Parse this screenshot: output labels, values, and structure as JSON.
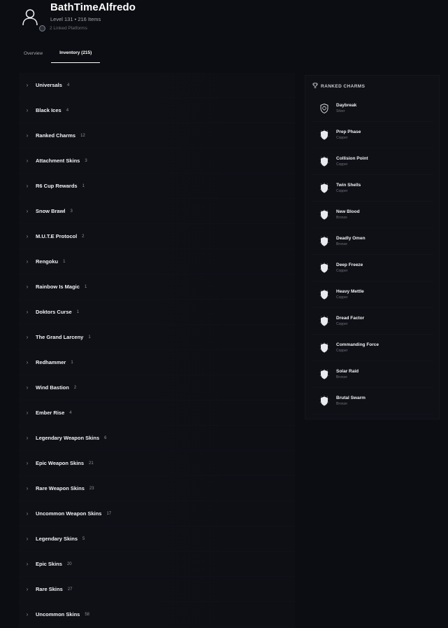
{
  "profile": {
    "username": "BathTimeAlfredo",
    "level_items": "Level 131 • 216 Items",
    "linked_platforms": "2 Linked Platforms"
  },
  "tabs": [
    {
      "label": "Overview",
      "active": false
    },
    {
      "label": "Inventory (215)",
      "active": true
    }
  ],
  "categories": [
    {
      "label": "Universals",
      "count": "4"
    },
    {
      "label": "Black Ices",
      "count": "4"
    },
    {
      "label": "Ranked Charms",
      "count": "12"
    },
    {
      "label": "Attachment Skins",
      "count": "3"
    },
    {
      "label": "R6 Cup Rewards",
      "count": "1"
    },
    {
      "label": "Snow Brawl",
      "count": "3"
    },
    {
      "label": "M.U.T.E Protocol",
      "count": "2"
    },
    {
      "label": "Rengoku",
      "count": "1"
    },
    {
      "label": "Rainbow Is Magic",
      "count": "1"
    },
    {
      "label": "Doktors Curse",
      "count": "1"
    },
    {
      "label": "The Grand Larceny",
      "count": "1"
    },
    {
      "label": "Redhammer",
      "count": "1"
    },
    {
      "label": "Wind Bastion",
      "count": "2"
    },
    {
      "label": "Ember Rise",
      "count": "4"
    },
    {
      "label": "Legendary Weapon Skins",
      "count": "6"
    },
    {
      "label": "Epic Weapon Skins",
      "count": "21"
    },
    {
      "label": "Rare Weapon Skins",
      "count": "23"
    },
    {
      "label": "Uncommon Weapon Skins",
      "count": "17"
    },
    {
      "label": "Legendary Skins",
      "count": "5"
    },
    {
      "label": "Epic Skins",
      "count": "20"
    },
    {
      "label": "Rare Skins",
      "count": "27"
    },
    {
      "label": "Uncommon Skins",
      "count": "58"
    }
  ],
  "ranked_charms": {
    "title": "RANKED CHARMS",
    "items": [
      {
        "name": "Daybreak",
        "tier": "Silver"
      },
      {
        "name": "Prep Phase",
        "tier": "Copper"
      },
      {
        "name": "Collision Point",
        "tier": "Copper"
      },
      {
        "name": "Twin Shells",
        "tier": "Copper"
      },
      {
        "name": "New Blood",
        "tier": "Bronze"
      },
      {
        "name": "Deadly Omen",
        "tier": "Bronze"
      },
      {
        "name": "Deep Freeze",
        "tier": "Copper"
      },
      {
        "name": "Heavy Mettle",
        "tier": "Copper"
      },
      {
        "name": "Dread Factor",
        "tier": "Copper"
      },
      {
        "name": "Commanding Force",
        "tier": "Copper"
      },
      {
        "name": "Solar Raid",
        "tier": "Bronze"
      },
      {
        "name": "Brutal Swarm",
        "tier": "Bronze"
      }
    ]
  },
  "icons": {
    "avatar": "user-silhouette-icon",
    "platform": "platform-icon",
    "chevron": "chevron-right-icon",
    "trophy": "trophy-icon",
    "charm": "shield-charm-icon"
  },
  "colors": {
    "background": "#0c0d12",
    "panel": "#0f1016",
    "text_primary": "#ffffff",
    "text_muted": "#a7a9b3"
  }
}
